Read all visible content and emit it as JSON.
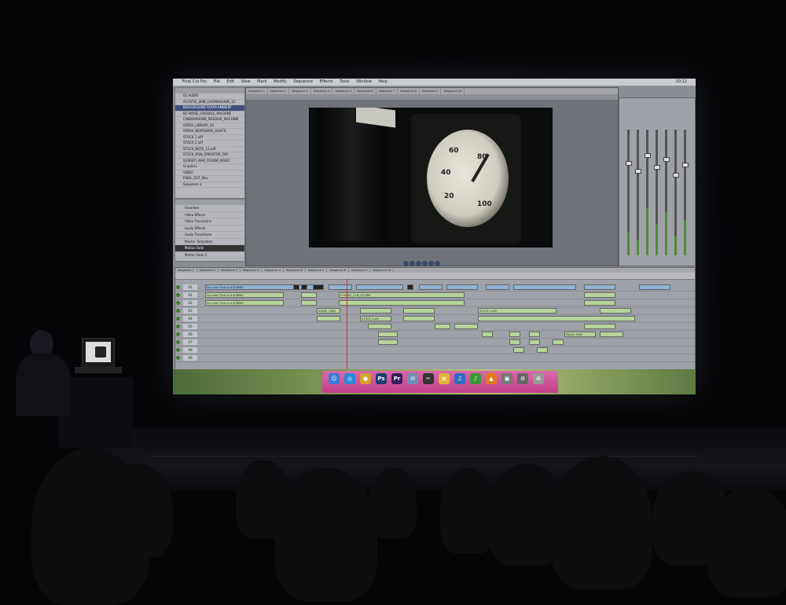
{
  "menubar": {
    "apple": "",
    "items": [
      "Final Cut Pro",
      "File",
      "Edit",
      "View",
      "Mark",
      "Modify",
      "Sequence",
      "Effects",
      "Tools",
      "Window",
      "Help"
    ],
    "clock": "20:12"
  },
  "browser": {
    "items": [
      {
        "label": "02 AUDIO",
        "selected": false
      },
      {
        "label": "ACOSTIC_AMB_CHOMAVISION_12",
        "selected": false
      },
      {
        "label": "BACKGROUND ROOM AMBIENT",
        "selected": true
      },
      {
        "label": "BG NOISE_CHORALE_MACHINE",
        "selected": false
      },
      {
        "label": "CINEMAPHONE_RESOLVE_MACHINE",
        "selected": false
      },
      {
        "label": "OPERA_LIBRARY_24",
        "selected": false
      },
      {
        "label": "OPERA_NORTHERN_LIGHTS",
        "selected": false
      },
      {
        "label": "STOCK 1.aiff",
        "selected": false
      },
      {
        "label": "STOCK 2.aiff",
        "selected": false
      },
      {
        "label": "STOCK_NOTE_12.aiff",
        "selected": false
      },
      {
        "label": "STOCK_RUN_OPERATOR_FAR",
        "selected": false
      },
      {
        "label": "SURRETI_MAX_STORM_VIDEO",
        "selected": false
      },
      {
        "label": "Graphics",
        "selected": false
      },
      {
        "label": "VIDEO",
        "selected": false
      },
      {
        "label": "FINAL_CUT_Mov",
        "selected": false
      },
      {
        "label": "Sequence 1",
        "selected": false
      }
    ]
  },
  "effects": {
    "rows": [
      {
        "label": "Favorites",
        "selected": false
      },
      {
        "label": "Video Effects",
        "selected": false
      },
      {
        "label": "Video Transitions",
        "selected": false
      },
      {
        "label": "Audio Effects",
        "selected": false
      },
      {
        "label": "Audio Transitions",
        "selected": false
      },
      {
        "label": "Master Templates",
        "selected": false
      },
      {
        "label": "Motion Fade",
        "selected": true
      },
      {
        "label": "Motion Fade 2",
        "selected": false
      }
    ]
  },
  "viewer": {
    "tabs": [
      "Sequence 1",
      "Sequence 2",
      "Sequence 3",
      "Sequence 4",
      "Sequence 5",
      "Sequence 6",
      "Sequence 7",
      "Sequence 8",
      "Sequence 9",
      "Sequence 10"
    ],
    "gauge_numbers": [
      "60",
      "80",
      "40",
      "20",
      "100"
    ]
  },
  "timeline": {
    "tabs": [
      "Sequence 1",
      "Sequence 2",
      "Sequence 3",
      "Sequence 4",
      "Sequence 5",
      "Sequence 6",
      "Sequence 7",
      "Sequence 8",
      "Sequence 9",
      "Sequence 10"
    ],
    "tracks": [
      "V1",
      "A1",
      "A2",
      "A3",
      "A4",
      "A5",
      "A6",
      "A7",
      "A8",
      "A9"
    ],
    "clips": {
      "v1_main": "Sun and Time 2nd SUNMIX",
      "a1_main": "Sun and Time 2nd SUNMIX",
      "a1_b": "SOURCE_CLIP_STORM",
      "a3_a": "AUDIO_GAIN",
      "a3_b": "STOCK 1.aiff",
      "a4_a": "STOCK 2.aiff",
      "a5_a": "Motion Fade"
    }
  },
  "dock": {
    "icons": [
      {
        "name": "finder-icon",
        "glyph": "☺",
        "color": "#3a7bd5"
      },
      {
        "name": "safari-icon",
        "glyph": "◎",
        "color": "#2a8ad8"
      },
      {
        "name": "chrome-icon",
        "glyph": "●",
        "color": "#d8a02a"
      },
      {
        "name": "photoshop-icon",
        "glyph": "Ps",
        "color": "#1c3f70"
      },
      {
        "name": "premiere-icon",
        "glyph": "Pr",
        "color": "#3b1b5c"
      },
      {
        "name": "mail-icon",
        "glyph": "✉",
        "color": "#6f8fb8"
      },
      {
        "name": "final-cut-icon",
        "glyph": "✂",
        "color": "#333"
      },
      {
        "name": "notes-icon",
        "glyph": "≡",
        "color": "#e0b83a"
      },
      {
        "name": "itunes-icon",
        "glyph": "♫",
        "color": "#2d6cc0"
      },
      {
        "name": "spotify-icon",
        "glyph": "♪",
        "color": "#3a9a3a"
      },
      {
        "name": "vlc-icon",
        "glyph": "▲",
        "color": "#e07a20"
      },
      {
        "name": "preview-icon",
        "glyph": "▣",
        "color": "#777"
      },
      {
        "name": "settings-icon",
        "glyph": "⚙",
        "color": "#666"
      },
      {
        "name": "trash-icon",
        "glyph": "♻",
        "color": "#999"
      }
    ]
  }
}
